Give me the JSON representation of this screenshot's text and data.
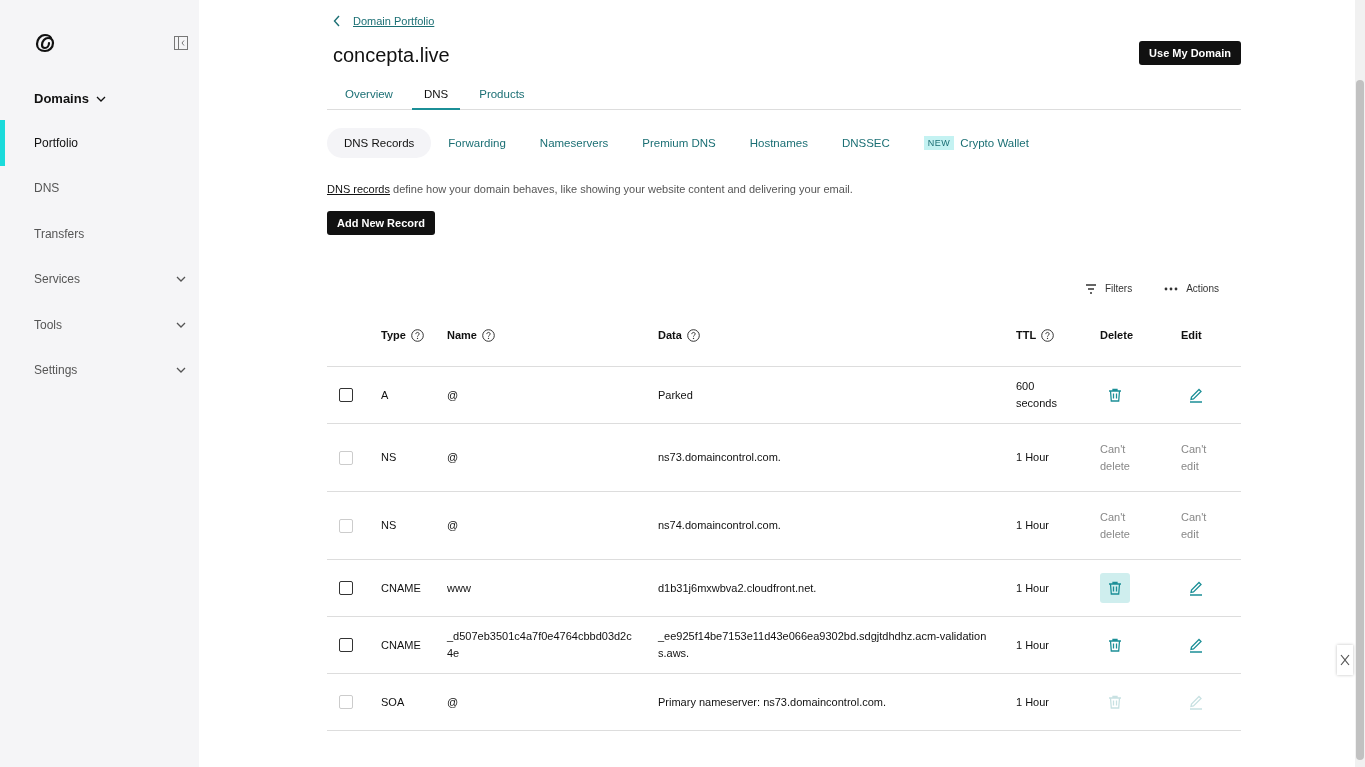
{
  "sidebar": {
    "section": {
      "label": "Domains",
      "expanded": true
    },
    "items": [
      {
        "label": "Portfolio",
        "selected": true,
        "expandable": false
      },
      {
        "label": "DNS",
        "selected": false,
        "expandable": false
      },
      {
        "label": "Transfers",
        "selected": false,
        "expandable": false
      },
      {
        "label": "Services",
        "selected": false,
        "expandable": true
      },
      {
        "label": "Tools",
        "selected": false,
        "expandable": true
      },
      {
        "label": "Settings",
        "selected": false,
        "expandable": true
      }
    ]
  },
  "breadcrumb": "Domain Portfolio",
  "title": "concepta.live",
  "primary_button": "Use My Domain",
  "tabs": [
    {
      "label": "Overview",
      "selected": false
    },
    {
      "label": "DNS",
      "selected": true
    },
    {
      "label": "Products",
      "selected": false
    }
  ],
  "subtabs": [
    {
      "label": "DNS Records",
      "selected": true
    },
    {
      "label": "Forwarding",
      "selected": false
    },
    {
      "label": "Nameservers",
      "selected": false
    },
    {
      "label": "Premium DNS",
      "selected": false
    },
    {
      "label": "Hostnames",
      "selected": false
    },
    {
      "label": "DNSSEC",
      "selected": false
    },
    {
      "label": "Crypto Wallet",
      "selected": false,
      "badge": "NEW"
    }
  ],
  "intro": {
    "link": "DNS records",
    "text": "define how your domain behaves, like showing your website content and delivering your email."
  },
  "add_button": "Add New Record",
  "toolbar": {
    "filters": "Filters",
    "actions": "Actions"
  },
  "table": {
    "columns": [
      {
        "label": "Type",
        "help": true
      },
      {
        "label": "Name",
        "help": true
      },
      {
        "label": "Data",
        "help": true
      },
      {
        "label": "TTL",
        "help": true
      },
      {
        "label": "Delete",
        "help": false
      },
      {
        "label": "Edit",
        "help": false
      }
    ],
    "rows": [
      {
        "checkbox_disabled": false,
        "type": "A",
        "name": "@",
        "data": "Parked",
        "ttl": "600 seconds",
        "delete": {
          "kind": "icon",
          "disabled": false,
          "hovered": false
        },
        "edit": {
          "kind": "icon",
          "disabled": false
        }
      },
      {
        "checkbox_disabled": true,
        "type": "NS",
        "name": "@",
        "data": "ns73.domaincontrol.com.",
        "ttl": "1 Hour",
        "delete": {
          "kind": "text",
          "text": "Can't delete"
        },
        "edit": {
          "kind": "text",
          "text": "Can't edit"
        }
      },
      {
        "checkbox_disabled": true,
        "type": "NS",
        "name": "@",
        "data": "ns74.domaincontrol.com.",
        "ttl": "1 Hour",
        "delete": {
          "kind": "text",
          "text": "Can't delete"
        },
        "edit": {
          "kind": "text",
          "text": "Can't edit"
        }
      },
      {
        "checkbox_disabled": false,
        "type": "CNAME",
        "name": "www",
        "data": "d1b31j6mxwbva2.cloudfront.net.",
        "ttl": "1 Hour",
        "delete": {
          "kind": "icon",
          "disabled": false,
          "hovered": true
        },
        "edit": {
          "kind": "icon",
          "disabled": false
        }
      },
      {
        "checkbox_disabled": false,
        "type": "CNAME",
        "name": "_d507eb3501c4a7f0e4764cbbd03d2c4e",
        "data": "_ee925f14be7153e11d43e066ea9302bd.sdgjtdhdhz.acm-validations.aws.",
        "ttl": "1 Hour",
        "delete": {
          "kind": "icon",
          "disabled": false,
          "hovered": false
        },
        "edit": {
          "kind": "icon",
          "disabled": false
        }
      },
      {
        "checkbox_disabled": true,
        "type": "SOA",
        "name": "@",
        "data": "Primary nameserver: ns73.domaincontrol.com.",
        "ttl": "1 Hour",
        "delete": {
          "kind": "icon",
          "disabled": true,
          "hovered": false
        },
        "edit": {
          "kind": "icon",
          "disabled": true
        }
      }
    ]
  }
}
